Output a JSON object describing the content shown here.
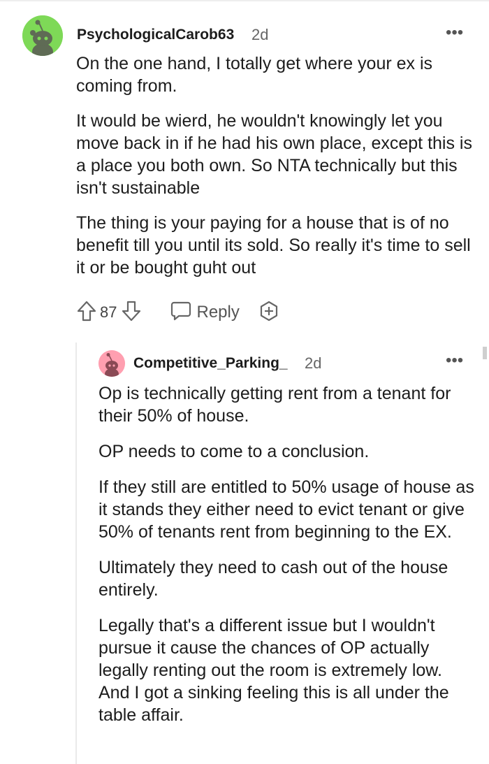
{
  "comment1": {
    "username": "PsychologicalCarob63",
    "age": "2d",
    "more_label": "•••",
    "paragraphs": [
      "On the one hand, I totally get where your ex is coming from.",
      "It would be wierd, he wouldn't knowingly let you move back in if he had his own place, except this is a place you both own. So NTA technically but this isn't sustainable",
      "The thing is your paying for a house that is of no benefit till you until its sold. So really it's time to sell it or be bought guht out"
    ],
    "actions": {
      "upvote_icon": "arrow-up-icon",
      "vote_count": "87",
      "downvote_icon": "arrow-down-icon",
      "reply_icon": "speech-bubble-icon",
      "reply_label": "Reply",
      "award_icon": "award-plus-icon"
    },
    "avatar_color": "#7ed957"
  },
  "comment2": {
    "username": "Competitive_Parking_",
    "age": "2d",
    "more_label": "•••",
    "paragraphs": [
      "Op is technically getting rent from a tenant for their 50% of house.",
      "OP needs to come to a conclusion.",
      "If they still are entitled to 50% usage of house as it stands they either need to evict tenant or give 50% of tenants rent from beginning to the EX.",
      "Ultimately they need to cash out of the house entirely.",
      "Legally that's a different issue but I wouldn't pursue it cause the chances of OP actually legally renting out the room is extremely low. And I got a sinking feeling this is all under the table affair."
    ],
    "avatar_color": "#ff9fb0"
  }
}
